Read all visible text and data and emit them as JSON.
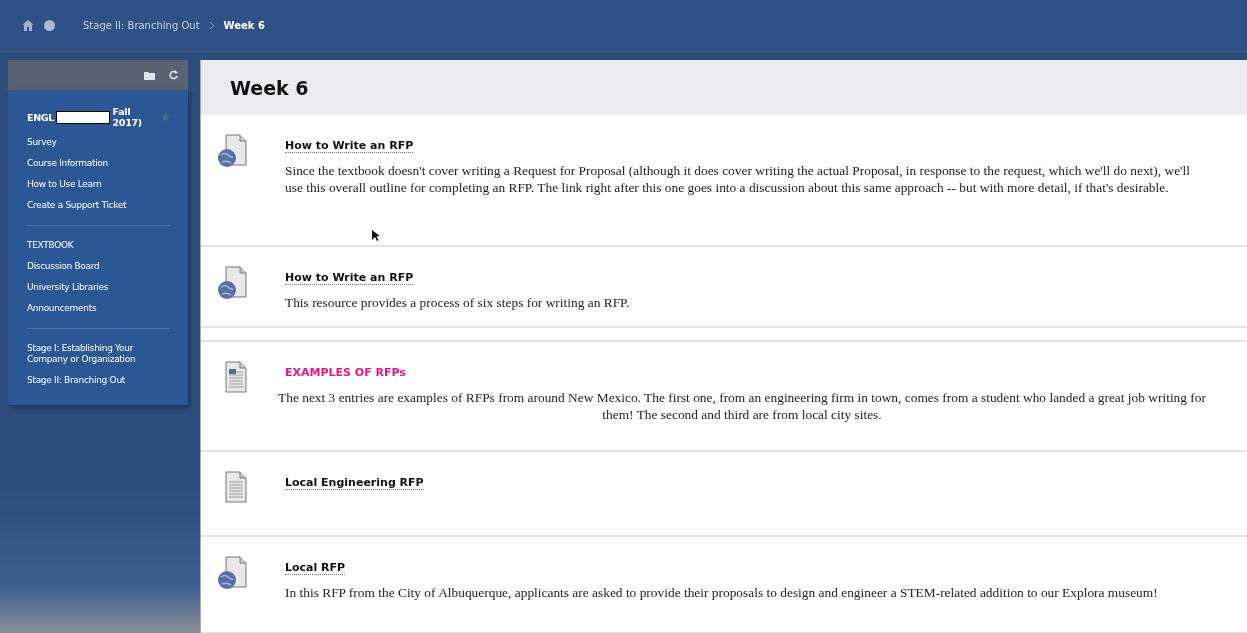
{
  "breadcrumb": {
    "items": [
      {
        "label": "Stage II: Branching Out",
        "current": false
      },
      {
        "label": "Week 6",
        "current": true
      }
    ]
  },
  "sidebar": {
    "course": {
      "prefix": "ENGL",
      "suffix": "Fall 2017)"
    },
    "groups": [
      [
        "Survey",
        "Course Information",
        "How to Use Learn",
        "Create a Support Ticket"
      ],
      [
        "TEXTBOOK",
        "Discussion Board",
        "University Libraries",
        "Announcements"
      ],
      [
        "Stage I: Establishing Your Company or Organization",
        "Stage II: Branching Out"
      ]
    ]
  },
  "page": {
    "title": "Week 6",
    "items": [
      {
        "kind": "web-link",
        "title": "How to Write an RFP",
        "description": "Since the textbook doesn't cover writing a Request for Proposal (although it does cover writing the actual Proposal, in response to the request, which we'll do next), we'll use this overall outline for completing an RFP. The link right after this one goes into a discussion about this same approach -- but with more detail, if that's desirable."
      },
      {
        "kind": "web-link",
        "title": "How to Write an RFP",
        "description": "This resource provides a process of six steps for writing an RFP."
      },
      {
        "kind": "item",
        "title": "EXAMPLES OF RFPs",
        "color": "#e8168a",
        "description": "The next 3 entries are examples of RFPs from around New Mexico. The first one, from an engineering firm in town, comes from a student who landed a great job writing for them! The second and third are from local city sites."
      },
      {
        "kind": "file",
        "title": "Local Engineering RFP"
      },
      {
        "kind": "web-link",
        "title": "Local RFP",
        "description": "In this RFP from the City of Albuquerque, applicants are asked to provide their proposals to design and engineer a STEM-related addition to our Explora museum!"
      }
    ]
  }
}
